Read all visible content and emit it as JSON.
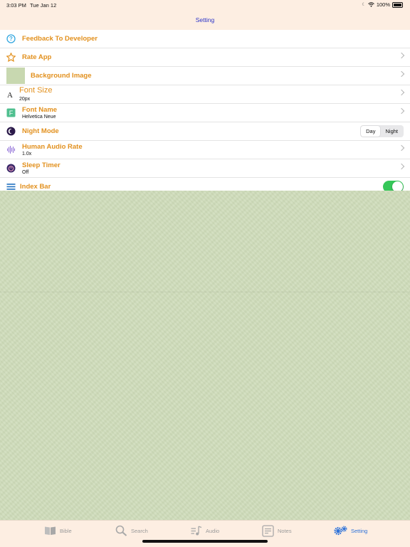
{
  "status": {
    "time": "3:03 PM",
    "date": "Tue Jan 12",
    "battery": "100%"
  },
  "nav": {
    "title": "Setting"
  },
  "settings": {
    "feedback": {
      "title": "Feedback To Developer"
    },
    "rate": {
      "title": "Rate App"
    },
    "background": {
      "title": "Background Image"
    },
    "font_size": {
      "title": "Font Size",
      "value": "20px"
    },
    "font_name": {
      "title": "Font Name",
      "value": "Helvetica Neue"
    },
    "night_mode": {
      "title": "Night Mode",
      "options": [
        "Day",
        "Night"
      ],
      "selected": "Day"
    },
    "audio_rate": {
      "title": "Human Audio Rate",
      "value": "1.0x"
    },
    "sleep_timer": {
      "title": "Sleep Timer",
      "value": "Off"
    },
    "index_bar": {
      "title": "Index Bar",
      "enabled": true
    }
  },
  "tabs": [
    {
      "label": "Bible",
      "icon": "book-icon"
    },
    {
      "label": "Search",
      "icon": "magnifier-icon"
    },
    {
      "label": "Audio",
      "icon": "music-list-icon"
    },
    {
      "label": "Notes",
      "icon": "note-icon"
    },
    {
      "label": "Setting",
      "icon": "gears-icon",
      "active": true
    }
  ],
  "colors": {
    "accent": "#e2901d",
    "title_blue": "#2a32c8",
    "tab_active": "#2f73d9",
    "toggle_on": "#36c759"
  }
}
